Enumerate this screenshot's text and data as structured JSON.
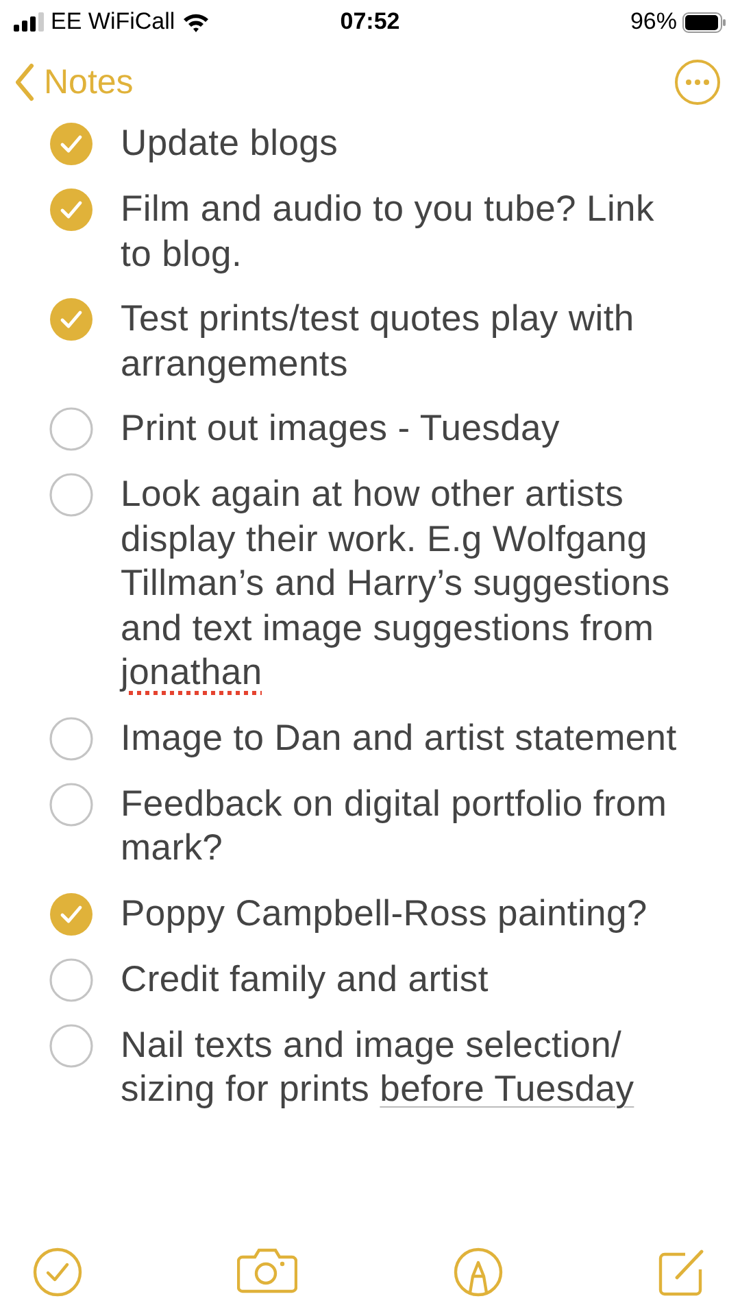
{
  "status_bar": {
    "carrier": "EE WiFiCall",
    "time": "07:52",
    "battery": "96%"
  },
  "nav": {
    "back": "Notes"
  },
  "items": [
    {
      "checked": true,
      "parts": [
        {
          "kind": "plain",
          "text": "Update blogs"
        }
      ]
    },
    {
      "checked": true,
      "parts": [
        {
          "kind": "plain",
          "text": "Film and audio to you tube? Link to blog."
        }
      ]
    },
    {
      "checked": true,
      "parts": [
        {
          "kind": "plain",
          "text": "Test prints/test quotes play with arrangements"
        }
      ]
    },
    {
      "checked": false,
      "parts": [
        {
          "kind": "plain",
          "text": "Print out images - Tuesday"
        }
      ]
    },
    {
      "checked": false,
      "parts": [
        {
          "kind": "plain",
          "text": "Look again at how other artists display their work. E.g Wolfgang Tillman’s and Harry’s suggestions and text image suggestions from "
        },
        {
          "kind": "misspelled",
          "text": "jonathan"
        }
      ]
    },
    {
      "checked": false,
      "parts": [
        {
          "kind": "plain",
          "text": "Image to Dan and artist statement"
        }
      ]
    },
    {
      "checked": false,
      "parts": [
        {
          "kind": "plain",
          "text": "Feedback on digital portfolio from mark?"
        }
      ]
    },
    {
      "checked": true,
      "parts": [
        {
          "kind": "plain",
          "text": "Poppy Campbell-Ross painting?"
        }
      ]
    },
    {
      "checked": false,
      "parts": [
        {
          "kind": "plain",
          "text": "Credit family and artist"
        }
      ]
    },
    {
      "checked": false,
      "parts": [
        {
          "kind": "plain",
          "text": "Nail texts and image selection/ sizing for prints "
        },
        {
          "kind": "date",
          "text": "before Tuesday"
        }
      ]
    }
  ]
}
